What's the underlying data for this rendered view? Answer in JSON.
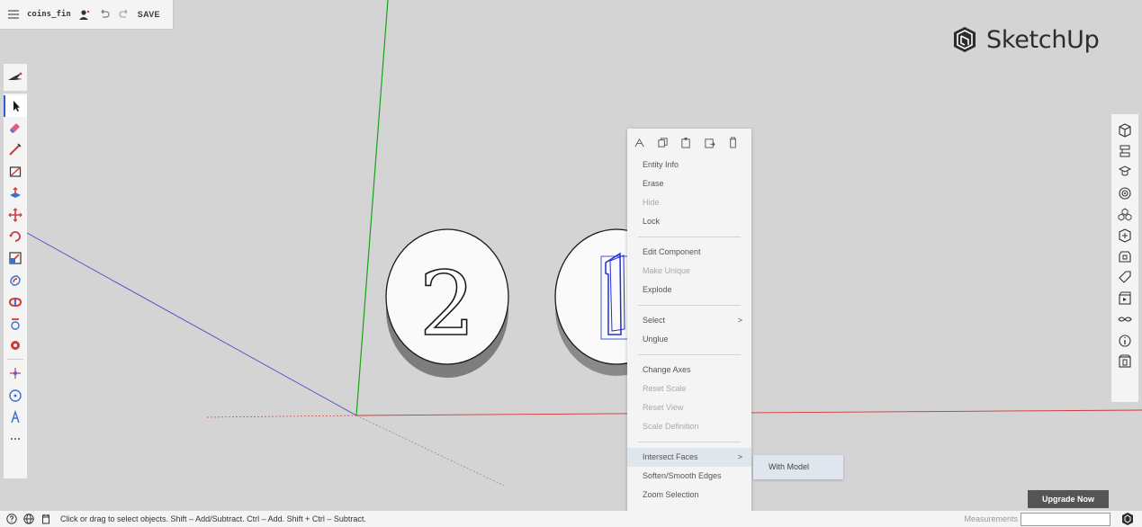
{
  "file_bar": {
    "menu_icon": "hamburger-menu-icon",
    "file_name": "coins_fin",
    "profile_icon": "user-profile-icon",
    "undo_icon": "undo-icon",
    "redo_icon": "redo-icon",
    "save_label": "SAVE"
  },
  "brand": {
    "name": "SketchUp",
    "logo_icon": "sketchup-logo-icon",
    "color": "#2c2c2c"
  },
  "left_toolbar": {
    "pinned_tool": "instructor-bird-icon",
    "tools": [
      "select-arrow-icon",
      "eraser-icon",
      "pencil-line-icon",
      "rectangle-icon",
      "push-pull-icon",
      "move-icon",
      "rotate-icon",
      "scale-icon",
      "offset-icon",
      "follow-me-icon",
      "tape-measure-icon",
      "paint-bucket-icon",
      "orbit-icon",
      "walk-icon",
      "text-icon",
      "more-tools-icon"
    ]
  },
  "right_panel": {
    "tools": [
      "entity-info-icon",
      "outliner-icon",
      "instructor-icon",
      "materials-icon",
      "components-icon",
      "styles-icon",
      "scenes-icon",
      "tags-icon",
      "shadows-icon",
      "views-icon",
      "solid-tools-icon",
      "model-info-icon"
    ]
  },
  "context_menu": {
    "icon_row": [
      "entity-info-quick-icon",
      "copy-icon",
      "paste-icon",
      "paste-in-place-icon",
      "delete-icon"
    ],
    "group1": [
      {
        "label": "Entity Info",
        "disabled": false
      },
      {
        "label": "Erase",
        "disabled": false
      },
      {
        "label": "Hide",
        "disabled": true
      },
      {
        "label": "Lock",
        "disabled": false
      }
    ],
    "group2": [
      {
        "label": "Edit Component",
        "disabled": false
      },
      {
        "label": "Make Unique",
        "disabled": true
      },
      {
        "label": "Explode",
        "disabled": false
      }
    ],
    "group3": [
      {
        "label": "Select",
        "disabled": false,
        "submenu": ">"
      },
      {
        "label": "Unglue",
        "disabled": false
      }
    ],
    "group4": [
      {
        "label": "Change Axes",
        "disabled": false
      },
      {
        "label": "Reset Scale",
        "disabled": true
      },
      {
        "label": "Reset View",
        "disabled": true
      },
      {
        "label": "Scale Definition",
        "disabled": true
      }
    ],
    "group5": [
      {
        "label": "Intersect Faces",
        "disabled": false,
        "submenu": ">",
        "highlighted": true
      },
      {
        "label": "Soften/Smooth Edges",
        "disabled": false
      },
      {
        "label": "Zoom Selection",
        "disabled": false
      }
    ],
    "submenu_item": "With Model"
  },
  "upgrade_button": "Upgrade Now",
  "status_bar": {
    "icons": [
      "help-icon",
      "globe-geolocate-icon",
      "credits-icon"
    ],
    "hint": "Click or drag to select objects. Shift – Add/Subtract. Ctrl – Add. Shift + Ctrl – Subtract."
  },
  "measurements": {
    "label": "Measurements",
    "value": ""
  },
  "scene": {
    "coin_left_number": "2",
    "coin_right_number": "1"
  },
  "colors": {
    "axis_green": "#19a319",
    "axis_red": "#d23a3a",
    "axis_blue": "#3b3bd0",
    "selection_blue": "#1f2fd6",
    "brand_blue": "#2563c9"
  }
}
